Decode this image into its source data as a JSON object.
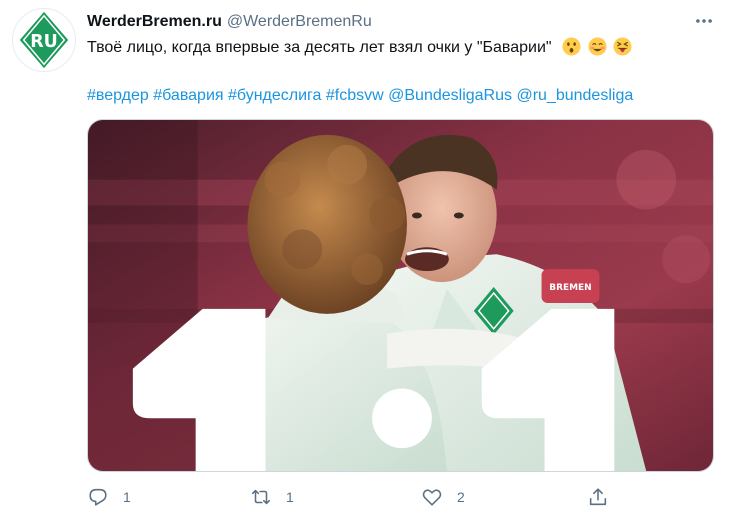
{
  "author": {
    "display_name": "WerderBremen.ru",
    "handle": "@WerderBremenRu",
    "avatar_text": "RU"
  },
  "tweet": {
    "text": "Твоё лицо, когда впервые за десять лет взял очки у \"Баварии\"",
    "emojis": [
      "hushed-face",
      "smiling-face-with-smiling-eyes",
      "squinting-face-with-tongue"
    ],
    "tags": [
      "#вердер",
      "#бавария",
      "#бундеслига",
      "#fcbsvw",
      "@BundesligaRus",
      "@ru_bundesliga"
    ]
  },
  "media": {
    "score_home": "1",
    "score_away": "1",
    "patch_text": "BREMEN"
  },
  "actions": {
    "reply": {
      "icon": "reply-icon",
      "count": "1"
    },
    "retweet": {
      "icon": "retweet-icon",
      "count": "1"
    },
    "like": {
      "icon": "heart-icon",
      "count": "2"
    },
    "share": {
      "icon": "share-icon"
    }
  },
  "colors": {
    "brand_green": "#1d9a5c",
    "link": "#1b95e0",
    "muted": "#5b7083",
    "bg_maroon": "#7a2a3c"
  }
}
